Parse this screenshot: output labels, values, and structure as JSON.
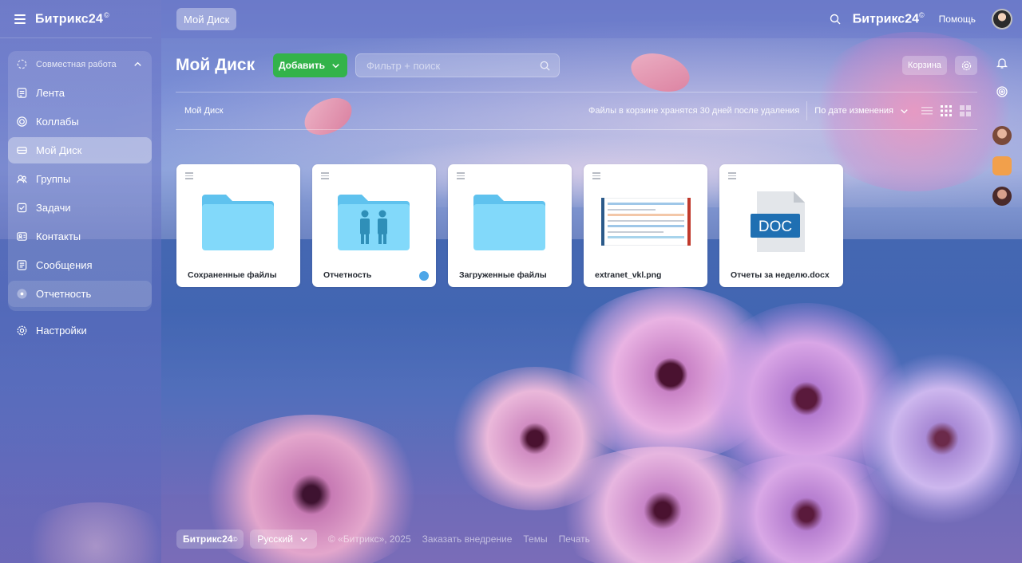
{
  "sidebar": {
    "brand": "Битрикс24",
    "brand_mark": "©",
    "group_label": "Совместная работа",
    "items": [
      {
        "label": "Лента",
        "icon": "feed-icon"
      },
      {
        "label": "Коллабы",
        "icon": "collab-icon"
      },
      {
        "label": "Мой Диск",
        "icon": "disk-icon"
      },
      {
        "label": "Группы",
        "icon": "groups-icon"
      },
      {
        "label": "Задачи",
        "icon": "tasks-icon"
      },
      {
        "label": "Контакты",
        "icon": "contacts-icon"
      },
      {
        "label": "Сообщения",
        "icon": "messages-icon"
      },
      {
        "label": "Отчетность",
        "icon": "reports-icon"
      }
    ],
    "settings_label": "Настройки"
  },
  "topbar": {
    "chip": "Мой Диск",
    "brand": "Битрикс24",
    "brand_mark": "©",
    "help": "Помощь"
  },
  "page": {
    "title": "Мой Диск",
    "add_button": "Добавить",
    "filter_placeholder": "Фильтр + поиск",
    "trash_button": "Корзина",
    "breadcrumb": "Мой Диск",
    "trash_note": "Файлы в корзине хранятся 30 дней после удаления",
    "sort_label": "По дате изменения"
  },
  "files": [
    {
      "name": "Сохраненные файлы",
      "type": "folder"
    },
    {
      "name": "Отчетность",
      "type": "shared-folder"
    },
    {
      "name": "Загруженные файлы",
      "type": "folder"
    },
    {
      "name": "extranet_vkl.png",
      "type": "image"
    },
    {
      "name": "Отчеты за неделю.docx",
      "type": "doc",
      "badge": "DOC"
    }
  ],
  "footer": {
    "brand": "Битрикс24",
    "brand_mark": "©",
    "language": "Русский",
    "copyright": "© «Битрикс», 2025",
    "links": [
      "Заказать внедрение",
      "Темы",
      "Печать"
    ]
  },
  "colors": {
    "accent_green": "#33b34a",
    "folder_blue": "#7fd3f5",
    "doc_blue": "#1f6fb2"
  }
}
